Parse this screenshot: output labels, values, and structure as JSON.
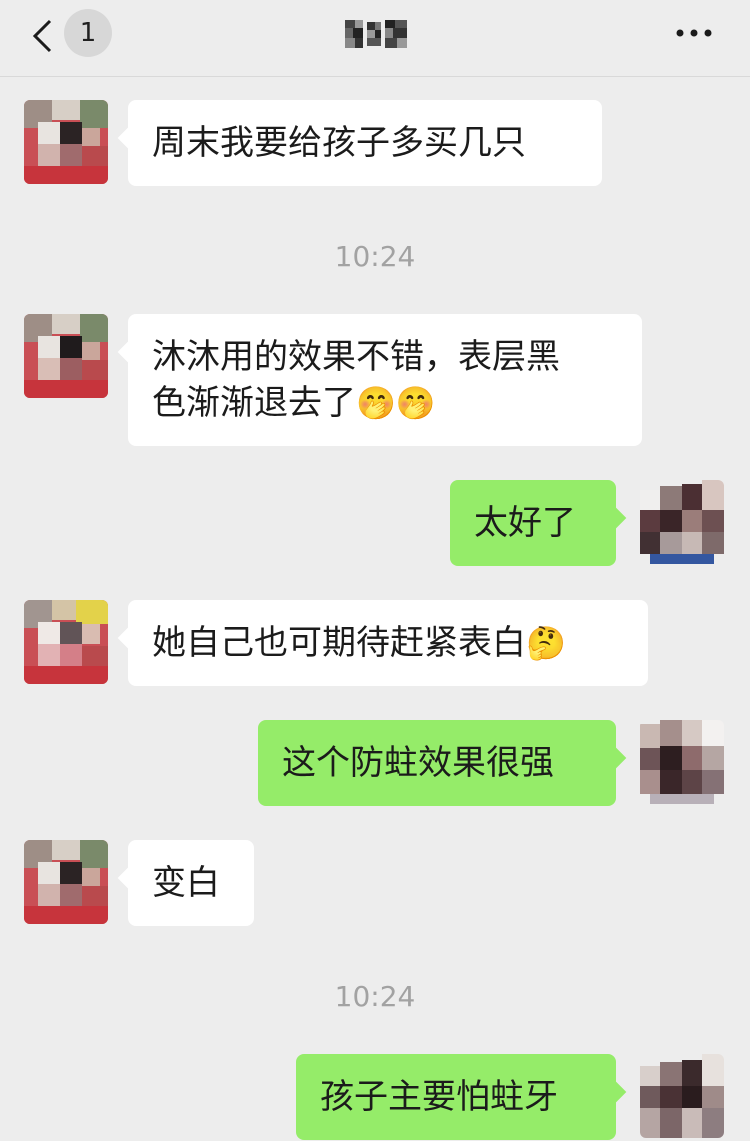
{
  "header": {
    "back_label": "Back",
    "unread_count": "1",
    "title_obscured": "pixelated contact name",
    "more_label": "More"
  },
  "messages": [
    {
      "side": "left",
      "text": "周末我要给孩子多买几只"
    },
    {
      "timestamp": "10:24"
    },
    {
      "side": "left",
      "line1": "沐沐用的效果不错，表层黑",
      "line2": "色渐渐退去了",
      "emoji": "🤭🤭"
    },
    {
      "side": "right",
      "text": "太好了"
    },
    {
      "side": "left",
      "text": "她自己也可期待赶紧表白",
      "emoji": "🤔"
    },
    {
      "side": "right",
      "text": "这个防蛀效果很强"
    },
    {
      "side": "left",
      "text": "变白"
    },
    {
      "timestamp": "10:24"
    },
    {
      "side": "right",
      "text": "孩子主要怕蛀牙"
    }
  ],
  "colors": {
    "background": "#ededed",
    "incoming_bubble": "#ffffff",
    "outgoing_bubble": "#95ec69",
    "timestamp": "#a2a2a2"
  }
}
